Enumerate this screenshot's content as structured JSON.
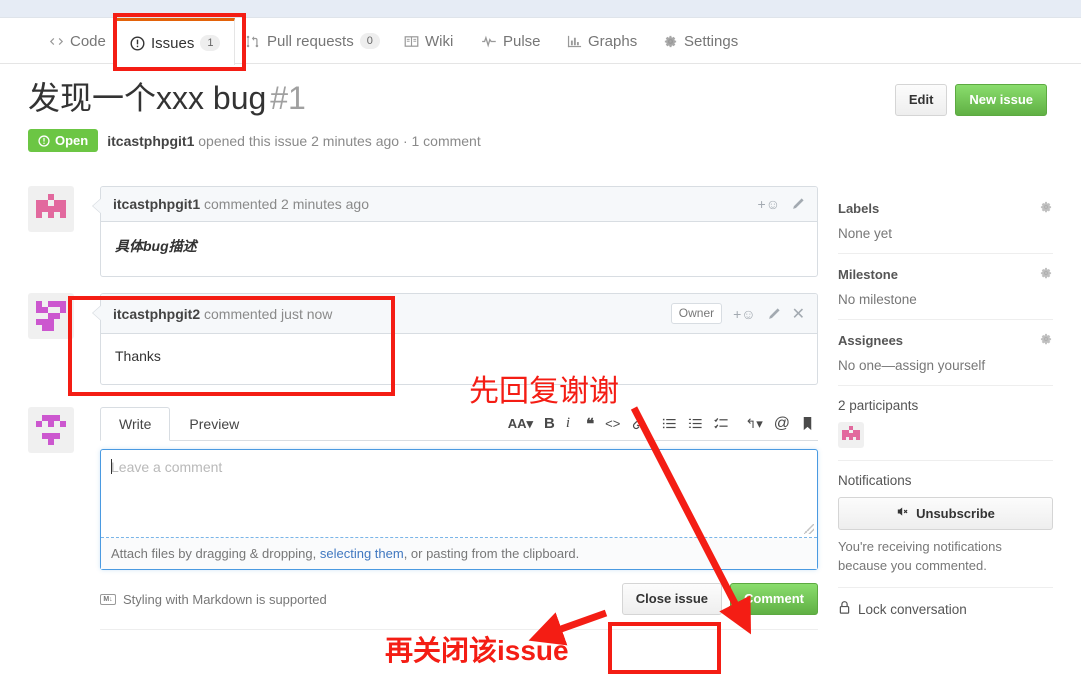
{
  "nav": {
    "items": [
      {
        "label": "Code",
        "icon": "code-icon",
        "count": null
      },
      {
        "label": "Issues",
        "icon": "issue-opened-icon",
        "count": "1",
        "selected": true
      },
      {
        "label": "Pull requests",
        "icon": "git-pull-request-icon",
        "count": "0"
      },
      {
        "label": "Wiki",
        "icon": "book-icon",
        "count": null
      },
      {
        "label": "Pulse",
        "icon": "pulse-icon",
        "count": null
      },
      {
        "label": "Graphs",
        "icon": "graph-icon",
        "count": null
      },
      {
        "label": "Settings",
        "icon": "gear-icon",
        "count": null
      }
    ]
  },
  "issue": {
    "title": "发现一个xxx bug",
    "number": "#1",
    "state": "Open",
    "state_color": "#6cc644",
    "meta_author": "itcastphpgit1",
    "meta_rest": " opened this issue 2 minutes ago · 1 comment",
    "edit_label": "Edit",
    "new_issue_label": "New issue"
  },
  "comments": [
    {
      "author": "itcastphpgit1",
      "action": " commented 2 minutes ago",
      "body": "具体bug描述",
      "body_style": "cjk",
      "owner_tag": null,
      "has_close": false
    },
    {
      "author": "itcastphpgit2",
      "action": " commented just now",
      "body": "Thanks",
      "body_style": "plain",
      "owner_tag": "Owner",
      "has_close": true
    }
  ],
  "editor": {
    "tab_write": "Write",
    "tab_preview": "Preview",
    "toolbar": [
      {
        "name": "heading-icon",
        "glyph": "AA▾"
      },
      {
        "name": "bold-icon",
        "glyph": "B"
      },
      {
        "name": "italic-icon",
        "glyph": "i"
      },
      {
        "name": "quote-icon",
        "glyph": "❝"
      },
      {
        "name": "code-icon",
        "glyph": "<>"
      },
      {
        "name": "link-icon",
        "glyph": "🔗"
      },
      {
        "name": "unordered-list-icon",
        "glyph": "☰"
      },
      {
        "name": "ordered-list-icon",
        "glyph": "☷"
      },
      {
        "name": "task-list-icon",
        "glyph": "✓☰"
      },
      {
        "name": "reply-icon",
        "glyph": "↩▾"
      },
      {
        "name": "mention-icon",
        "glyph": "@"
      },
      {
        "name": "bookmark-icon",
        "glyph": "🔖"
      }
    ],
    "placeholder": "Leave a comment",
    "attach_pre": "Attach files by dragging & dropping, ",
    "attach_link": "selecting them",
    "attach_post": ", or pasting from the clipboard.",
    "markdown_note": "Styling with Markdown is supported",
    "markdown_badge": "M↓",
    "close_issue_label": "Close issue",
    "comment_label": "Comment"
  },
  "sidebar": {
    "labels_title": "Labels",
    "labels_value": "None yet",
    "milestone_title": "Milestone",
    "milestone_value": "No milestone",
    "assignees_title": "Assignees",
    "assignees_value": "No one—assign yourself",
    "participants_title": "2 participants",
    "notifications_title": "Notifications",
    "unsubscribe_label": "Unsubscribe",
    "notifications_note": "You're receiving notifications because you commented.",
    "lock_label": "Lock conversation"
  },
  "annotations": {
    "note_reply": "先回复谢谢",
    "note_close": "再关闭该issue",
    "color": "#f41d14"
  }
}
